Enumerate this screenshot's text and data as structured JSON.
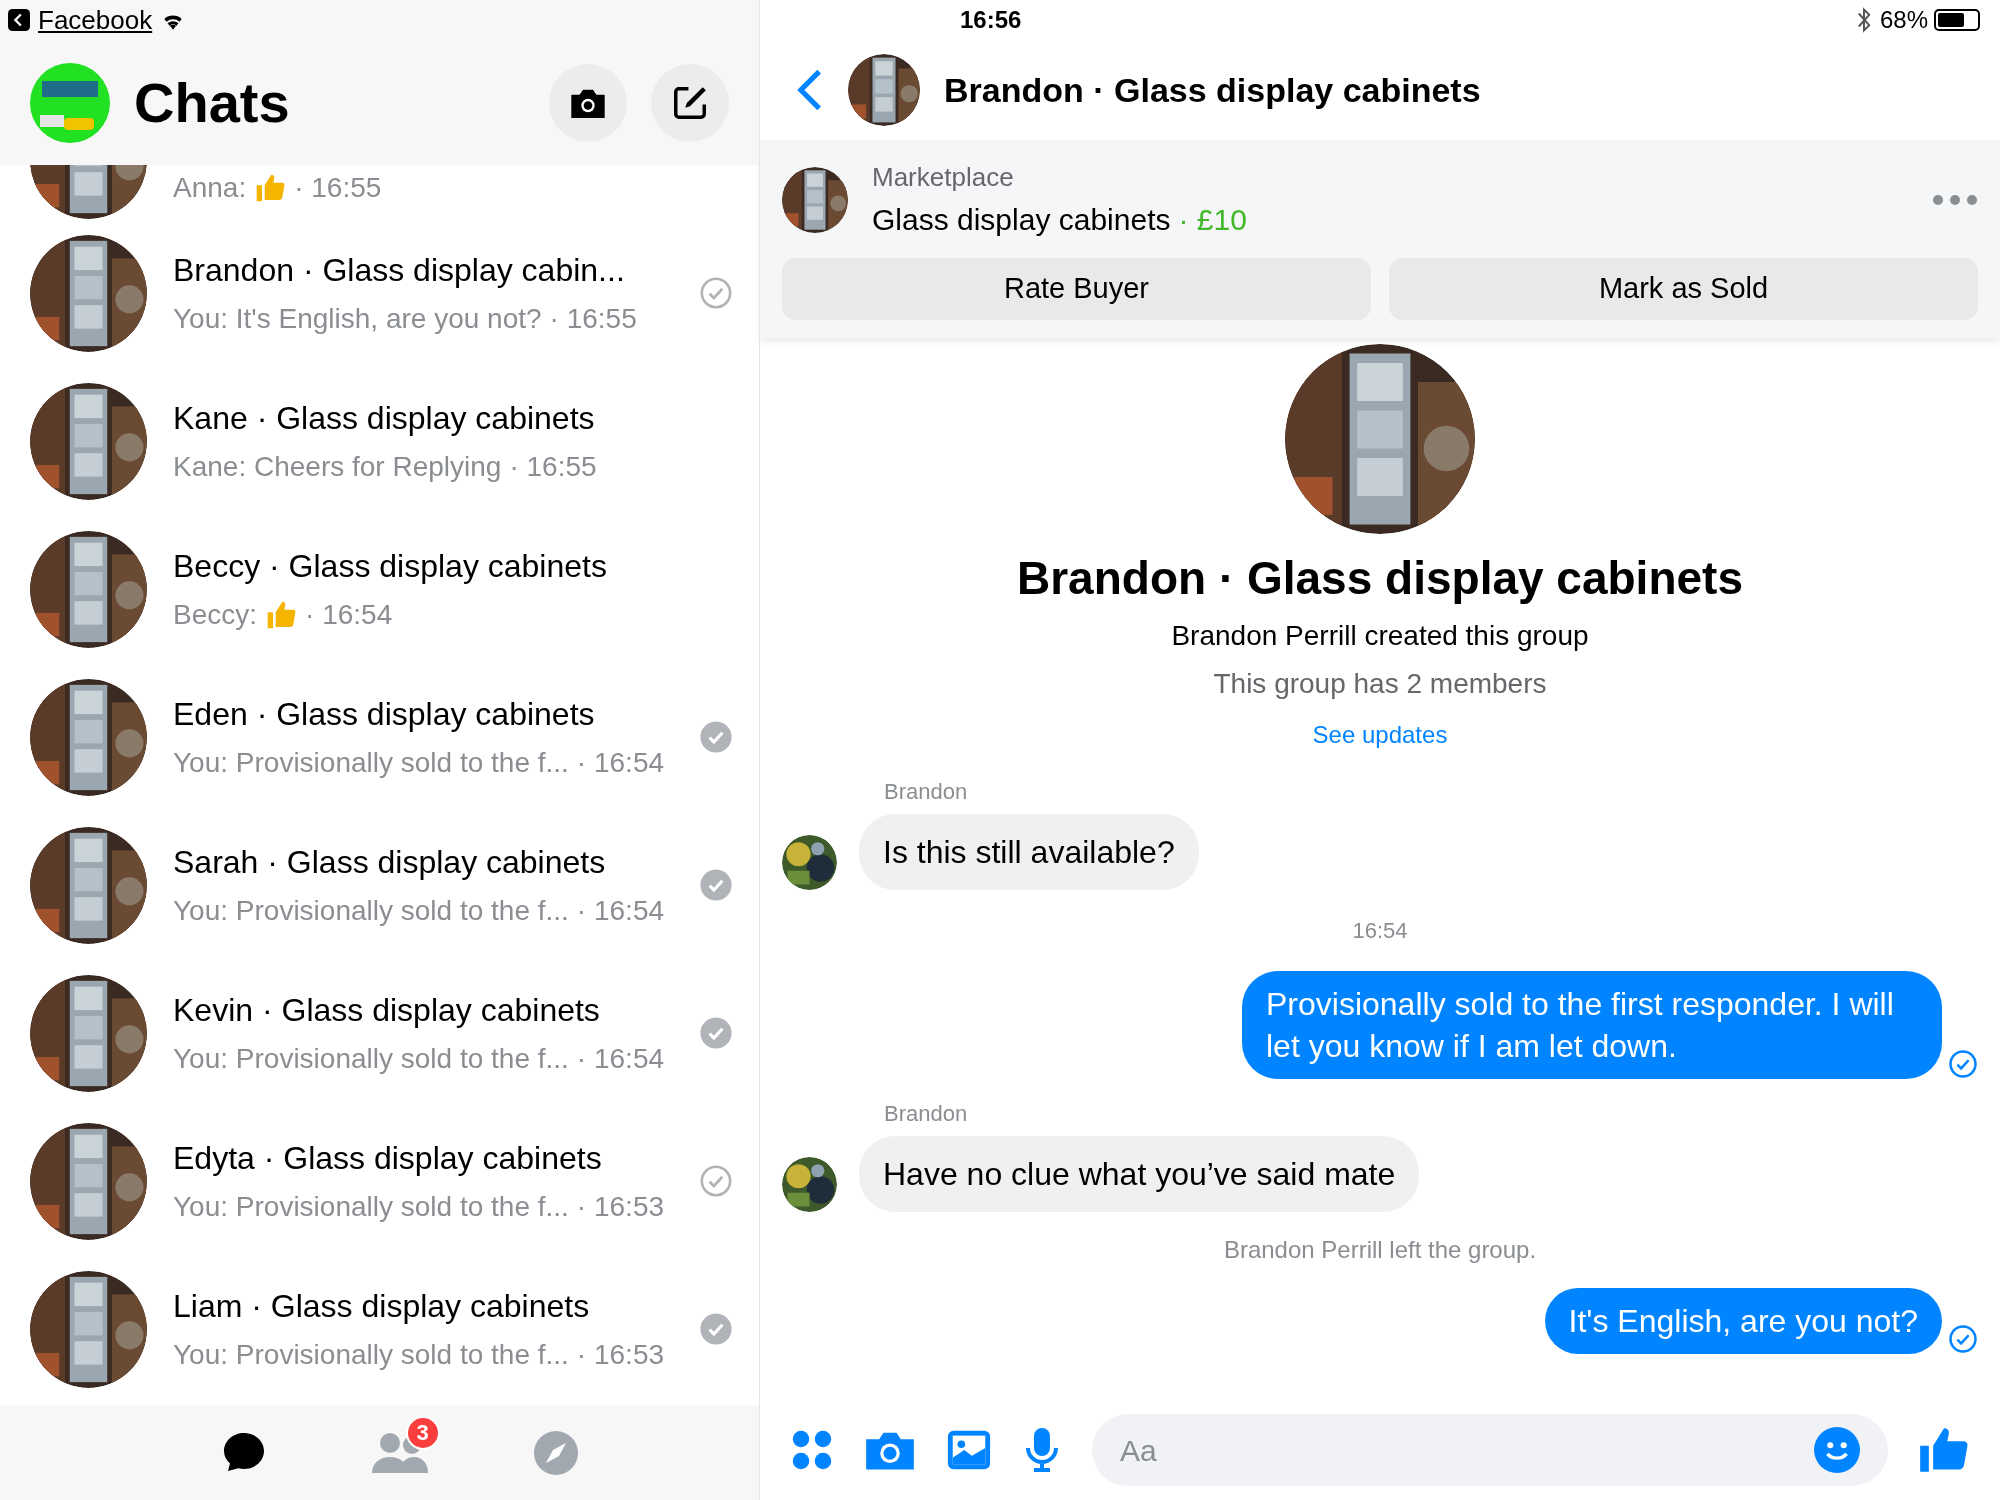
{
  "status_bar": {
    "back_app": "Facebook",
    "time": "16:56",
    "battery_text": "68%",
    "battery": {
      "level": 0.68
    }
  },
  "chats_header": {
    "title": "Chats"
  },
  "chats": [
    {
      "preview": "Anna:",
      "thumb": true,
      "time": "· 16:55",
      "sent": false,
      "delivered": false
    },
    {
      "name": "Brandon · Glass display cabin...",
      "preview": "You: It's English, are you not?",
      "thumb": false,
      "time": "· 16:55",
      "sent": true,
      "delivered": false
    },
    {
      "name": "Kane · Glass display cabinets",
      "preview": "Kane: Cheers for Replying",
      "thumb": false,
      "time": "· 16:55",
      "sent": false,
      "delivered": false
    },
    {
      "name": "Beccy · Glass display cabinets",
      "preview": "Beccy:",
      "thumb": true,
      "time": "· 16:54",
      "sent": false,
      "delivered": false
    },
    {
      "name": "Eden · Glass display cabinets",
      "preview": "You: Provisionally sold to the f...",
      "thumb": false,
      "time": "· 16:54",
      "sent": true,
      "delivered": true
    },
    {
      "name": "Sarah · Glass display cabinets",
      "preview": "You: Provisionally sold to the f...",
      "thumb": false,
      "time": "· 16:54",
      "sent": true,
      "delivered": true
    },
    {
      "name": "Kevin · Glass display cabinets",
      "preview": "You: Provisionally sold to the f...",
      "thumb": false,
      "time": "· 16:54",
      "sent": true,
      "delivered": true
    },
    {
      "name": "Edyta · Glass display cabinets",
      "preview": "You: Provisionally sold to the f...",
      "thumb": false,
      "time": "· 16:53",
      "sent": true,
      "delivered": false
    },
    {
      "name": "Liam · Glass display cabinets",
      "preview": "You: Provisionally sold to the f...",
      "thumb": false,
      "time": "· 16:53",
      "sent": true,
      "delivered": true
    }
  ],
  "bottom_tabs": [
    {
      "kind": "chats",
      "selected": true
    },
    {
      "kind": "people",
      "selected": false,
      "badge": "3"
    },
    {
      "kind": "discover",
      "selected": false
    }
  ],
  "conversation": {
    "title": "Brandon · Glass display cabinets",
    "listing": {
      "label": "Marketplace",
      "item": "Glass display cabinets",
      "price": "· £10",
      "buttons": [
        "Rate Buyer",
        "Mark as Sold"
      ]
    },
    "group": {
      "title": "Brandon · Glass display cabinets",
      "created": "Brandon Perrill created this group",
      "members": "This group has 2 members",
      "link": "See updates"
    },
    "messages": [
      {
        "kind": "incoming",
        "sender": "Brandon",
        "text": "Is this still available?"
      },
      {
        "kind": "timestamp",
        "text": "16:54"
      },
      {
        "kind": "outgoing",
        "text": "Provisionally sold to the first responder. I will let you know if I am let down.",
        "seen": true
      },
      {
        "kind": "incoming",
        "sender": "Brandon",
        "text": "Have no clue what you’ve said mate"
      },
      {
        "kind": "event",
        "text": "Brandon Perrill left the group."
      },
      {
        "kind": "outgoing",
        "text": "It's English, are you not?",
        "seen": true
      }
    ],
    "composer": {
      "placeholder": "Aa"
    }
  }
}
